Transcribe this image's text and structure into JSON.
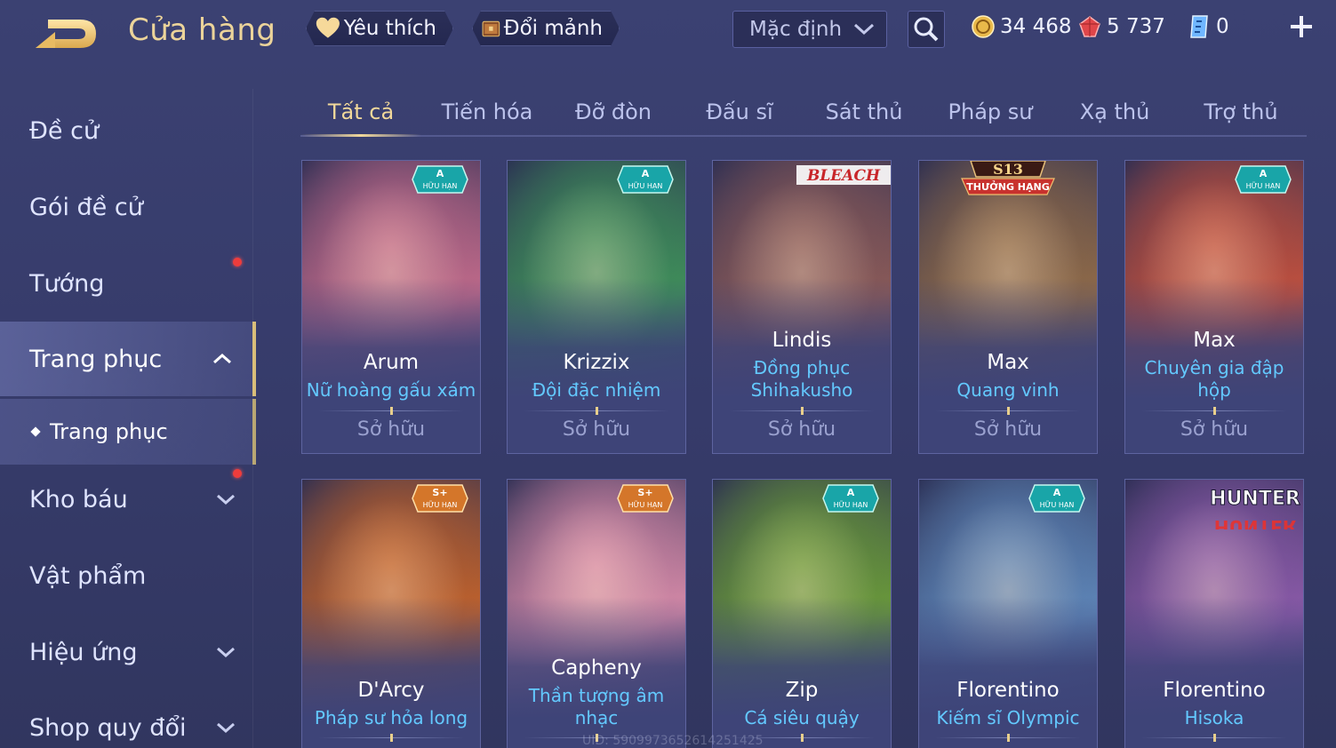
{
  "header": {
    "title": "Cửa hàng",
    "favorites_label": "Yêu thích",
    "exchange_label": "Đổi mảnh",
    "sort_value": "Mặc định",
    "currencies": {
      "gold": "34 468",
      "voucher": "5 737",
      "coupon": "0"
    }
  },
  "sidebar": {
    "items": [
      {
        "label": "Đề cử"
      },
      {
        "label": "Gói đề cử"
      },
      {
        "label": "Tướng"
      },
      {
        "label": "Trang phục"
      },
      {
        "label": "Trang phục"
      },
      {
        "label": "Kho báu"
      },
      {
        "label": "Vật phẩm"
      },
      {
        "label": "Hiệu ứng"
      },
      {
        "label": "Shop quy đổi"
      }
    ]
  },
  "tabs": [
    "Tất cả",
    "Tiến hóa",
    "Đỡ đòn",
    "Đấu sĩ",
    "Sát thủ",
    "Pháp sư",
    "Xạ thủ",
    "Trợ thủ"
  ],
  "cards": [
    {
      "hero": "Arum",
      "skin": "Nữ hoàng gấu xám",
      "status": "Sở hữu",
      "badge_tier": "A",
      "badge_text": "HỮU HẠN",
      "accent": "#c06a8a"
    },
    {
      "hero": "Krizzix",
      "skin": "Đội đặc nhiệm",
      "status": "Sở hữu",
      "badge_tier": "A",
      "badge_text": "HỮU HẠN",
      "accent": "#3f8f5a"
    },
    {
      "hero": "Lindis",
      "skin": "Đồng phục Shihakusho",
      "status": "Sở hữu",
      "badge_text": "BLEACH",
      "accent": "#8a5a58"
    },
    {
      "hero": "Max",
      "skin": "Quang vinh",
      "status": "Sở hữu",
      "badge_tier": "S13",
      "badge_text": "THƯỞNG HẠNG",
      "accent": "#8f6a48"
    },
    {
      "hero": "Max",
      "skin": "Chuyên gia đập hộp",
      "status": "Sở hữu",
      "badge_tier": "A",
      "badge_text": "HỮU HẠN",
      "accent": "#c0503e"
    },
    {
      "hero": "D'Arcy",
      "skin": "Pháp sư hỏa long",
      "badge_tier": "S+",
      "badge_text": "HỮU HẠN",
      "accent": "#c0622c"
    },
    {
      "hero": "Capheny",
      "skin": "Thần tượng âm nhạc",
      "badge_tier": "S+",
      "badge_text": "HỮU HẠN",
      "accent": "#d68aa8"
    },
    {
      "hero": "Zip",
      "skin": "Cá siêu quậy",
      "badge_tier": "A",
      "badge_text": "HỮU HẠN",
      "accent": "#6a9a3a"
    },
    {
      "hero": "Florentino",
      "skin": "Kiếm sĩ Olympic",
      "badge_tier": "A",
      "badge_text": "HỮU HẠN",
      "accent": "#5e86b8"
    },
    {
      "hero": "Florentino",
      "skin": "Hisoka",
      "badge_text": "HUNTER",
      "accent": "#8a5aa8"
    }
  ],
  "watermark": "UID: 5909973652614251425",
  "colors": {
    "gold_accent": "#f1d89a",
    "skin_name": "#63c9ff",
    "notification": "#ee3c3c"
  }
}
